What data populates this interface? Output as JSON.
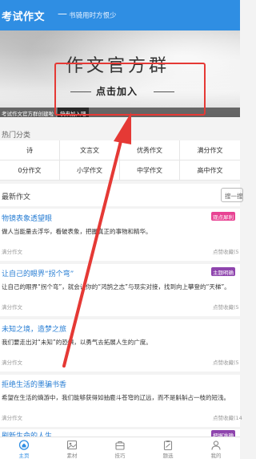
{
  "header": {
    "title": "考试作文",
    "dash": "—",
    "subtitle": "书骑用时方恨少"
  },
  "banner": {
    "headline": "作文官方群",
    "cta": "点击加入",
    "caption": "考试作文官方群创建啦",
    "caption_tag": "快来加入吧"
  },
  "categories": {
    "heading": "热门分类",
    "items": [
      "诗",
      "文言文",
      "优秀作文",
      "满分作文",
      "0分作文",
      "小学作文",
      "中学作文",
      "高中作文"
    ]
  },
  "latest": {
    "heading": "最新作文",
    "search_label": "搜一搜"
  },
  "articles": [
    {
      "title": "物镜表象透望眼",
      "desc": "做人当能量去浮华，看破表象，把握真正的事物和精华。",
      "category": "满分作文",
      "stats": "点赞收藏(5",
      "badge": "观点犀利",
      "badge_color": "#e84393"
    },
    {
      "title": "让自己的眼界“拐个弯”",
      "desc": "让自己的眼界“拐个弯”，就会让你的“鸿鹄之志”与现实对接，找到向上攀登的“天梯”。",
      "category": "满分作文",
      "stats": "点赞收藏(5",
      "badge": "主题明确",
      "badge_color": "#8e44ad"
    },
    {
      "title": "未知之境，造梦之旅",
      "desc": "我们要走出对“未知”的恐惧，以勇气去拓展人生的广度。",
      "category": "满分作文",
      "stats": "点赞收藏(5",
      "badge": "",
      "badge_color": ""
    },
    {
      "title": "拒绝生活的墨骗书香",
      "desc": "希望在生活的熵游中，我们能够获得如抽鹿斗苍穹的辽远，而不是斛斛占一枝的短浅。",
      "category": "满分作文",
      "stats": "点赞收藏(14",
      "badge": "",
      "badge_color": ""
    },
    {
      "title": "刷新生命的人生",
      "desc": "",
      "category": "",
      "stats": "",
      "badge": "把握准确",
      "badge_color": "#8e44ad"
    }
  ],
  "tabbar": {
    "items": [
      {
        "label": "主页",
        "icon": "home-icon"
      },
      {
        "label": "素材",
        "icon": "gallery-icon"
      },
      {
        "label": "技巧",
        "icon": "bag-icon"
      },
      {
        "label": "题选",
        "icon": "clipboard-icon"
      },
      {
        "label": "我的",
        "icon": "user-icon"
      }
    ],
    "active_color": "#2f8ee3"
  },
  "colors": {
    "primary": "#2f8ee3",
    "annotation_red": "#e53935"
  }
}
